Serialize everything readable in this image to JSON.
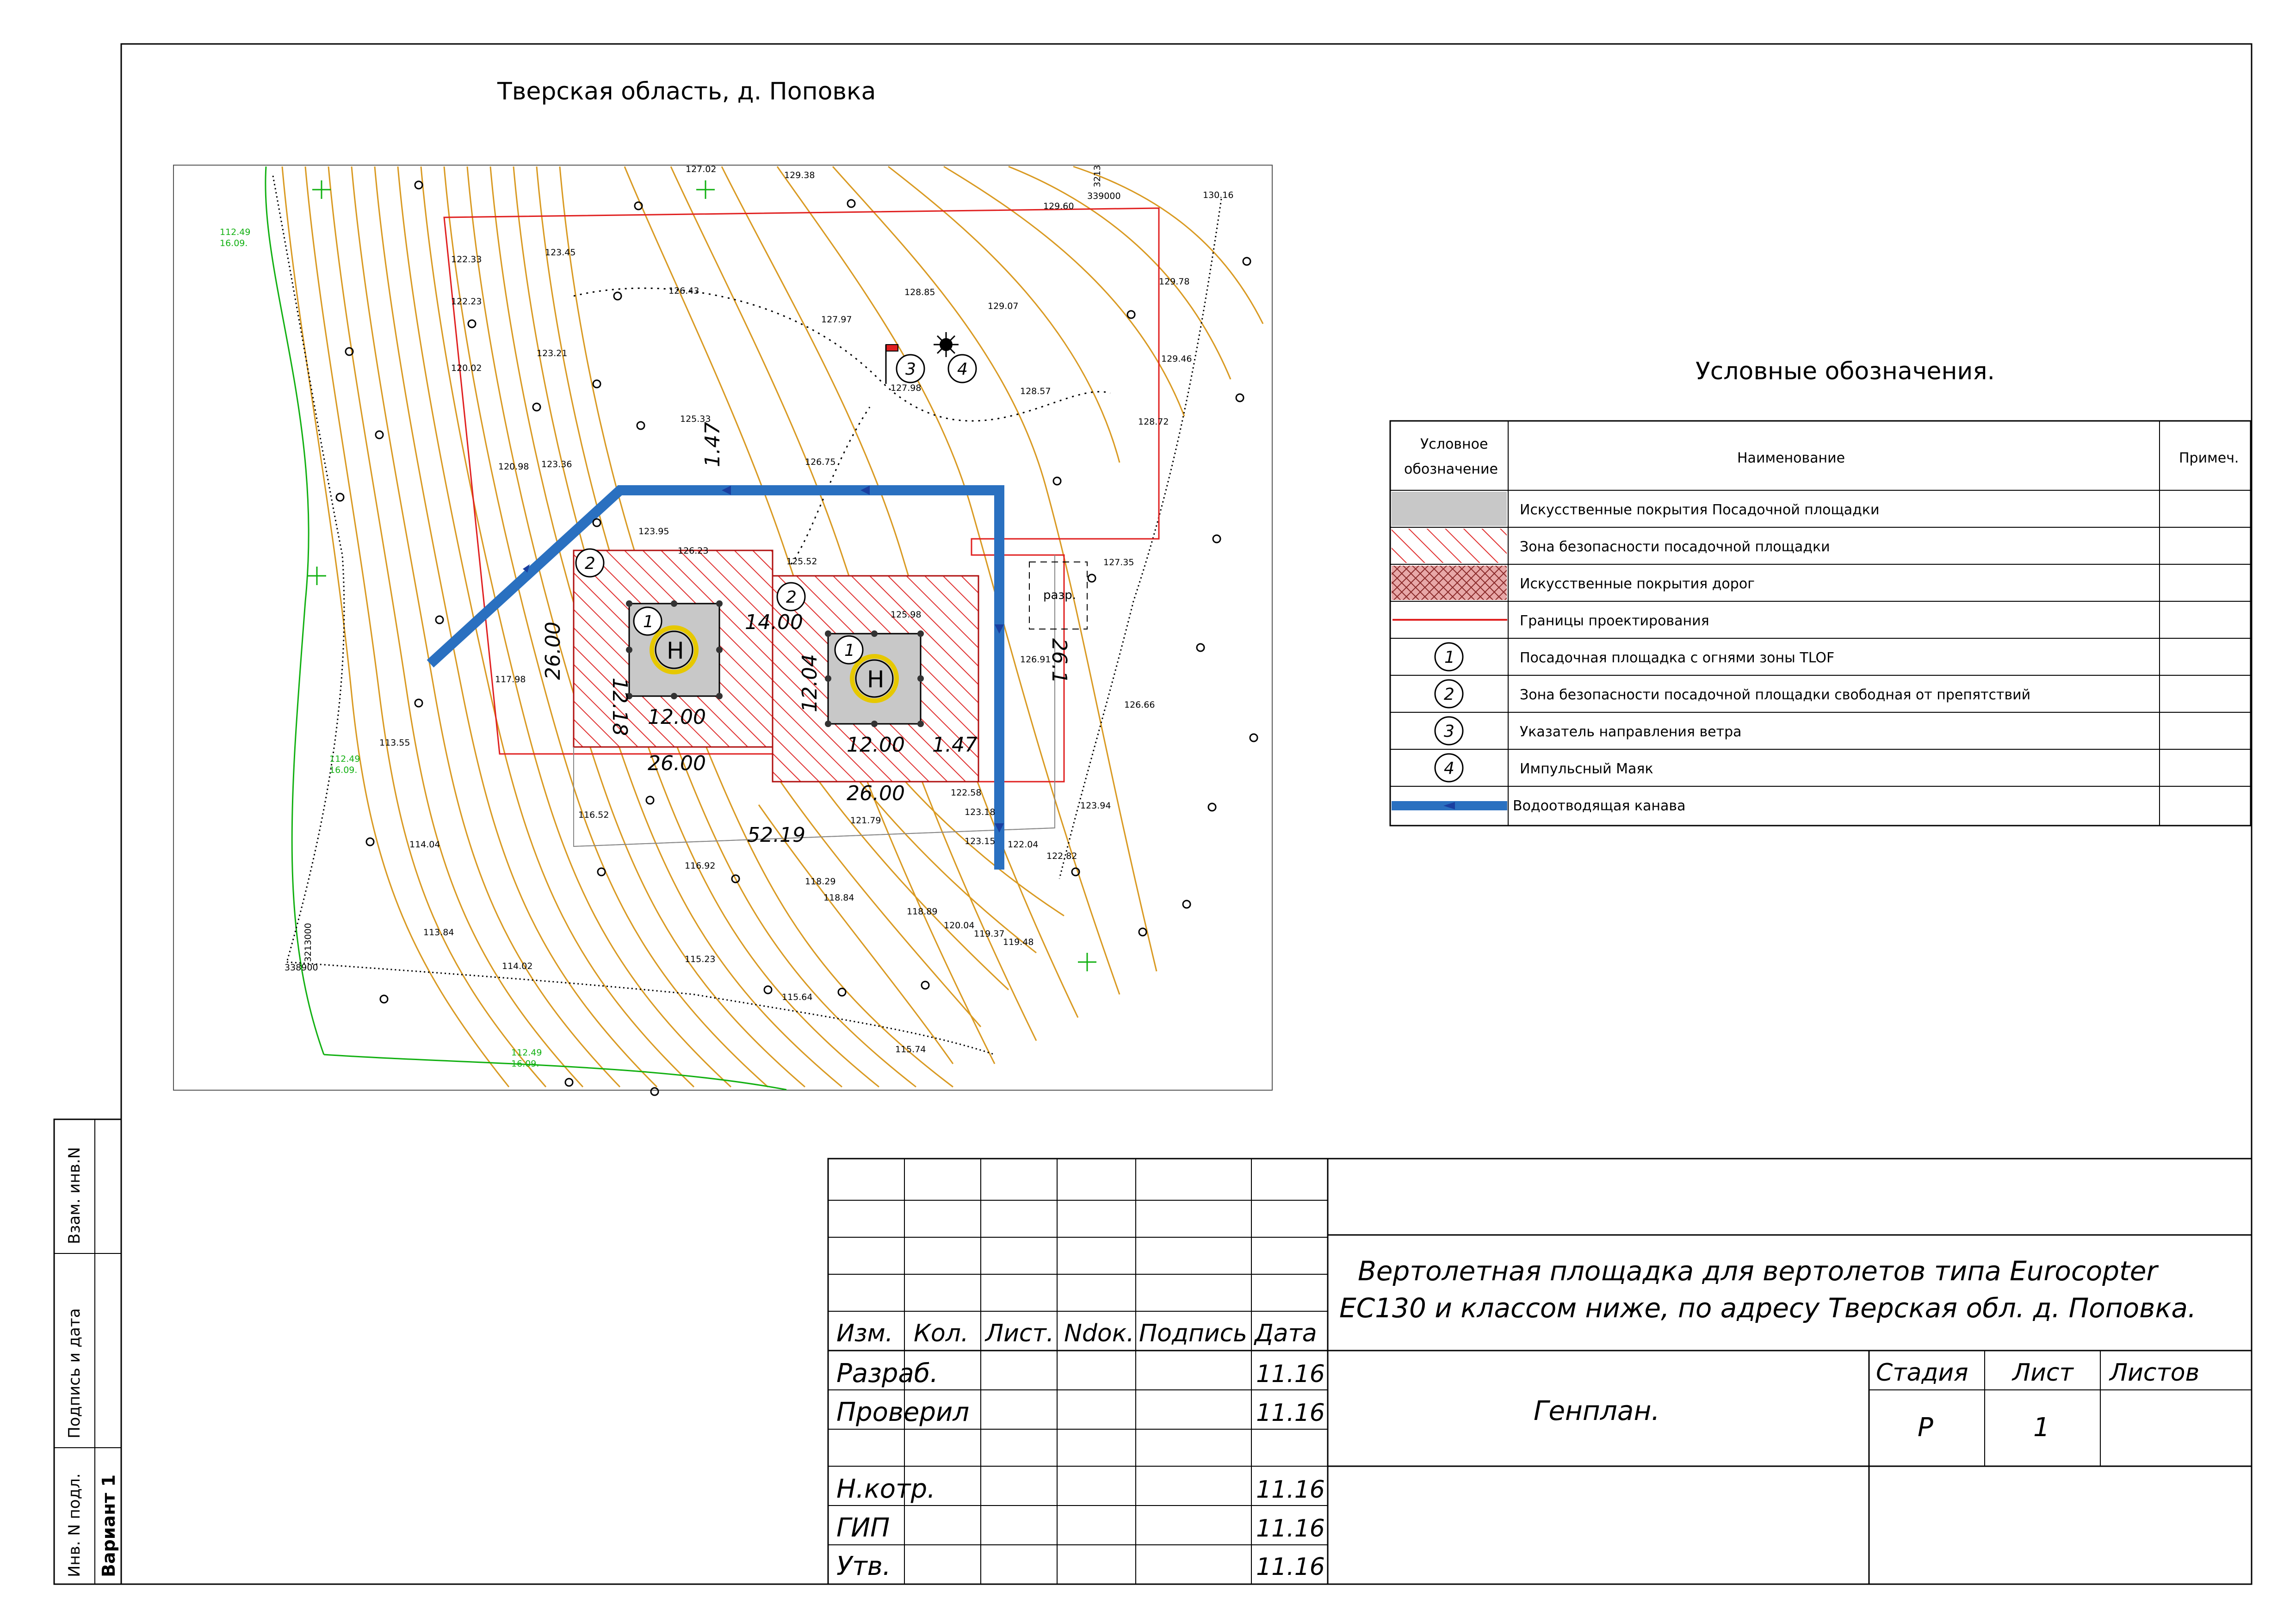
{
  "title": "Тверская область, д. Поповка",
  "map": {
    "elevations": [
      "127.02",
      "129.38",
      "129.60",
      "130.16",
      "129.78",
      "129.46",
      "128.72",
      "128.85",
      "129.07",
      "127.97",
      "126.43",
      "123.45",
      "122.33",
      "122.23",
      "120.02",
      "123.21",
      "120.98",
      "123.36",
      "125.33",
      "126.75",
      "128.57",
      "127.98",
      "123.95",
      "126.23",
      "125.52",
      "125.98",
      "127.35",
      "126.91",
      "126.66",
      "123.94",
      "122.82",
      "122.04",
      "123.15",
      "123.18",
      "122.58",
      "121.79",
      "116.52",
      "116.92",
      "118.29",
      "118.84",
      "118.89",
      "120.04",
      "119.37",
      "119.48",
      "115.23",
      "114.02",
      "113.84",
      "114.04",
      "113.55",
      "117.98",
      "115.64",
      "115.74"
    ],
    "survey_labels": [
      "112.49",
      "16.09.",
      "112.49",
      "16.09.",
      "112.49",
      "16.09."
    ],
    "coords": [
      "339000",
      "3213",
      "338900",
      "3213000"
    ],
    "dims": {
      "d1": "26.00",
      "d2": "12.18",
      "d3": "12.00",
      "d4": "26.00",
      "d5": "14.00",
      "d6": "12.04",
      "d7": "12.00",
      "d8": "26.00",
      "d9": "1.47",
      "d10": "52.19",
      "d11": "1.47",
      "d12": "26.1"
    },
    "helipad_letter": "H",
    "callouts": [
      "1",
      "2",
      "1",
      "2",
      "3",
      "4"
    ],
    "razr": "разр."
  },
  "legend": {
    "title": "Условные обозначения.",
    "col_symbol": "Условное обозначение",
    "col_name": "Наименование",
    "col_note": "Примеч.",
    "rows": [
      {
        "symbol": "",
        "name": "Искусственные покрытия Посадочной площадки"
      },
      {
        "symbol": "",
        "name": "Зона безопасности посадочной площадки"
      },
      {
        "symbol": "",
        "name": "Искусственные покрытия дорог"
      },
      {
        "symbol": "",
        "name": "Границы проектирования"
      },
      {
        "symbol": "1",
        "name": "Посадочная площадка с огнями зоны TLOF"
      },
      {
        "symbol": "2",
        "name": "Зона безопасности посадочной площадки свободная от препятствий"
      },
      {
        "symbol": "3",
        "name": "Указатель направления ветра"
      },
      {
        "symbol": "4",
        "name": "Импульсный Маяк"
      },
      {
        "symbol": "",
        "name": "Водоотводящая канава"
      }
    ]
  },
  "stamp": {
    "headers": [
      "Изм.",
      "Кол.",
      "Лист.",
      "Ndок.",
      "Подпись",
      "Дата"
    ],
    "project": [
      "Вертолетная площадка для вертолетов типа Eurocopter",
      "EC130 и классом ниже, по адресу Тверская обл. д. Поповка."
    ],
    "roles": [
      {
        "role": "Разраб.",
        "date": "11.16"
      },
      {
        "role": "Проверил",
        "date": "11.16"
      },
      {
        "role": "",
        "date": ""
      },
      {
        "role": "Н.котр.",
        "date": "11.16"
      },
      {
        "role": "ГИП",
        "date": "11.16"
      },
      {
        "role": "Утв.",
        "date": "11.16"
      }
    ],
    "sheet_title": "Генплан.",
    "stage_label": "Стадия",
    "sheet_label": "Лист",
    "sheets_label": "Листов",
    "stage": "Р",
    "sheet": "1",
    "sheets": ""
  },
  "side": {
    "vzam": "Взам. инв.N",
    "podpis": "Подпись и дата",
    "inv": "Инв. N подл.",
    "variant": "Вариант 1"
  },
  "colors": {
    "contour": "#d99a22",
    "boundary": "#e02020",
    "hatch": "#e03030",
    "ditch": "#2a70c0",
    "pad": "#c8c8c8",
    "survey": "#12b012"
  }
}
